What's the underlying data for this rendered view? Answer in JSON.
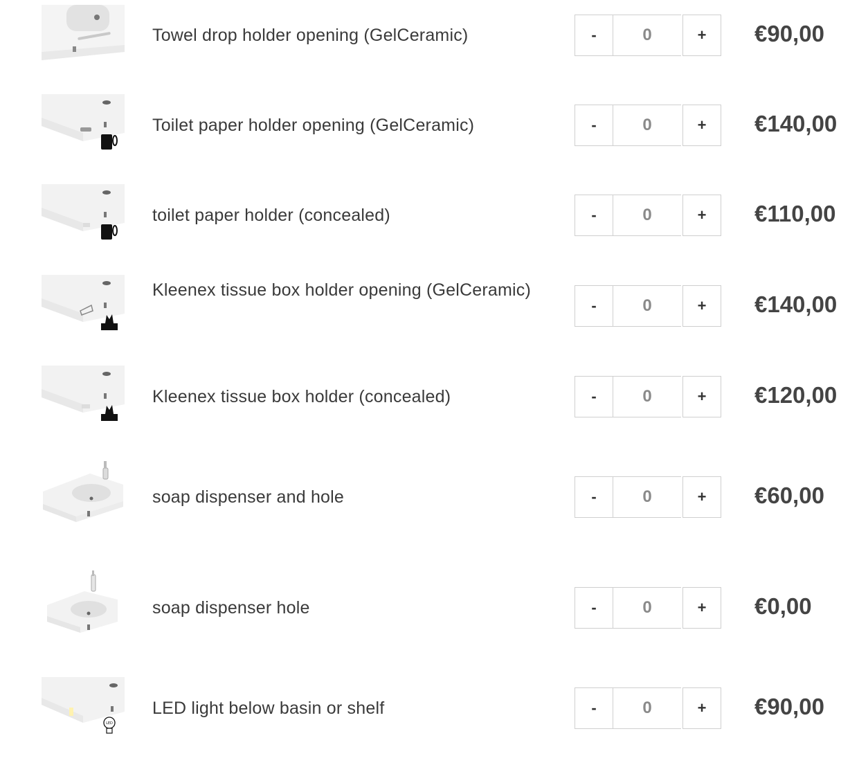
{
  "options": [
    {
      "label": "Towel drop holder opening (GelCeramic)",
      "quantity": "0",
      "price": "€90,00",
      "badge_icon": "none"
    },
    {
      "label": "Toilet paper holder opening (GelCeramic)",
      "quantity": "0",
      "price": "€140,00",
      "badge_icon": "toilet-paper-icon"
    },
    {
      "label": "toilet paper holder (concealed)",
      "quantity": "0",
      "price": "€110,00",
      "badge_icon": "toilet-paper-icon"
    },
    {
      "label": "Kleenex tissue box holder opening (GelCeramic)",
      "quantity": "0",
      "price": "€140,00",
      "badge_icon": "tissue-box-icon"
    },
    {
      "label": "Kleenex tissue box holder (concealed)",
      "quantity": "0",
      "price": "€120,00",
      "badge_icon": "tissue-box-icon"
    },
    {
      "label": "soap dispenser and hole",
      "quantity": "0",
      "price": "€60,00",
      "badge_icon": "none"
    },
    {
      "label": "soap dispenser hole",
      "quantity": "0",
      "price": "€0,00",
      "badge_icon": "none"
    },
    {
      "label": "LED light below basin or shelf",
      "quantity": "0",
      "price": "€90,00",
      "badge_icon": "led-bulb-icon"
    }
  ],
  "controls": {
    "minus_label": "-",
    "plus_label": "+"
  },
  "led_badge_text": "LED"
}
